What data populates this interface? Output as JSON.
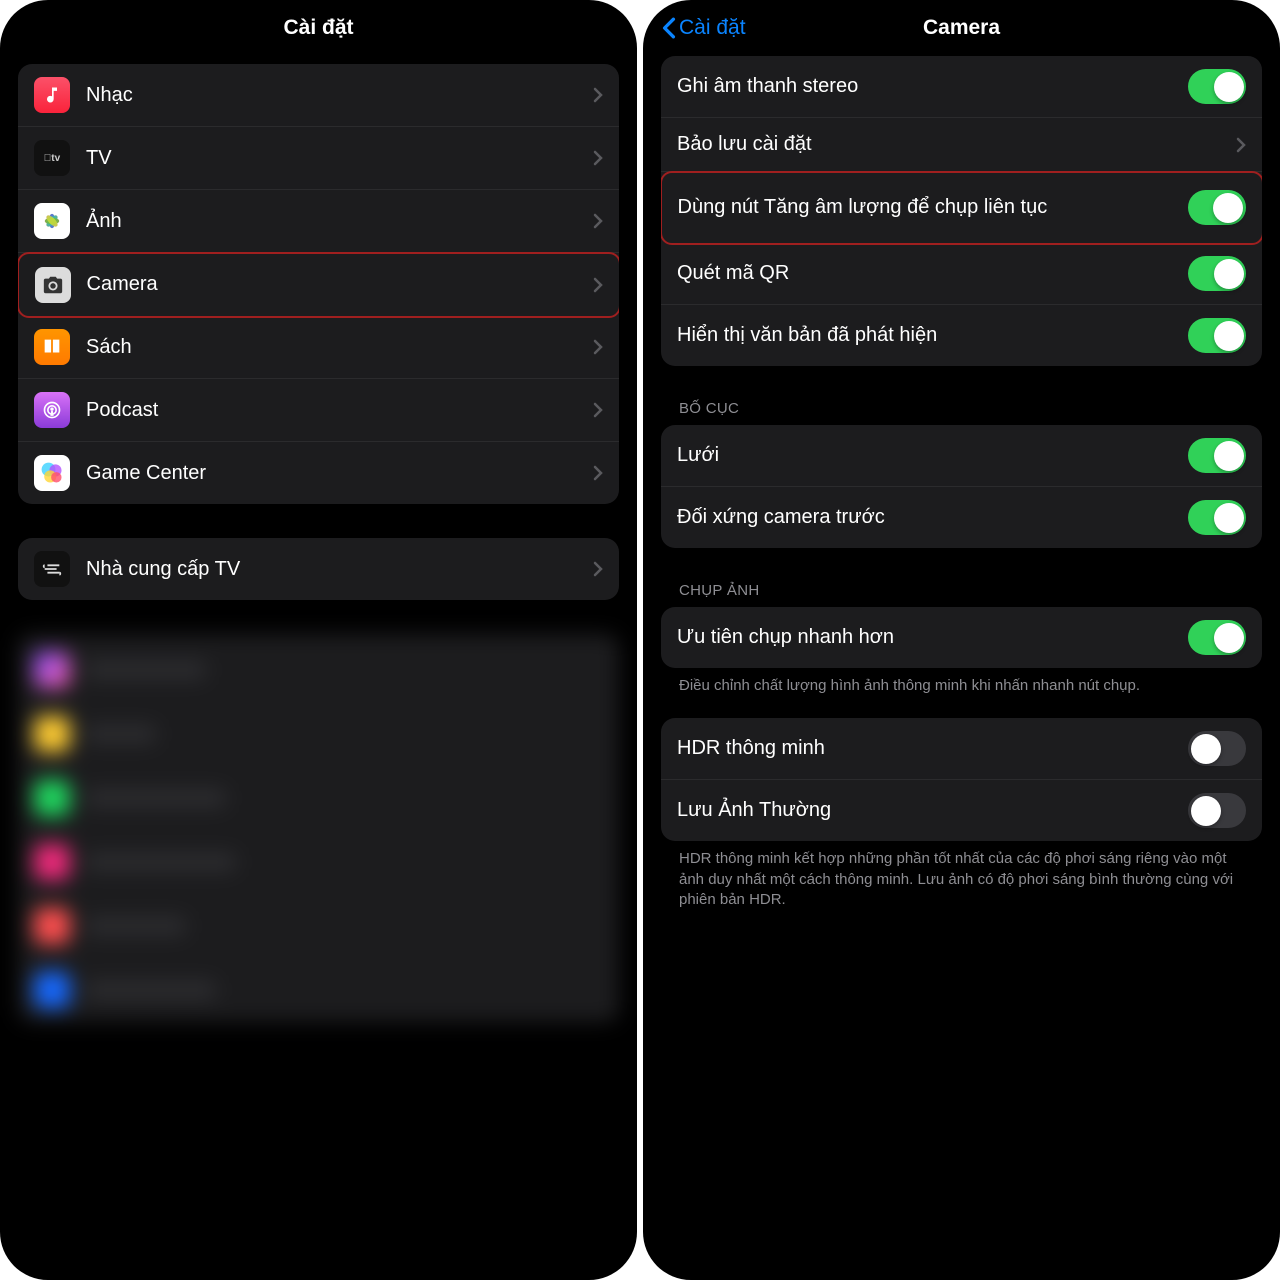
{
  "left": {
    "title": "Cài đặt",
    "group1": [
      {
        "label": "Nhạc",
        "icon": "music"
      },
      {
        "label": "TV",
        "icon": "tv"
      },
      {
        "label": "Ảnh",
        "icon": "photos"
      },
      {
        "label": "Camera",
        "icon": "camera",
        "highlight": true
      },
      {
        "label": "Sách",
        "icon": "books"
      },
      {
        "label": "Podcast",
        "icon": "podcast"
      },
      {
        "label": "Game Center",
        "icon": "game-center"
      }
    ],
    "group2": [
      {
        "label": "Nhà cung cấp TV",
        "icon": "tv-provider"
      }
    ]
  },
  "right": {
    "back": "Cài đặt",
    "title": "Camera",
    "group_top": [
      {
        "label": "Ghi âm thanh stereo",
        "toggle": true
      },
      {
        "label": "Bảo lưu cài đặt",
        "type": "link"
      },
      {
        "label": "Dùng nút Tăng âm lượng để chụp liên tục",
        "toggle": true,
        "highlight": true
      },
      {
        "label": "Quét mã QR",
        "toggle": true
      },
      {
        "label": "Hiển thị văn bản đã phát hiện",
        "toggle": true
      }
    ],
    "layout_header": "BỐ CỤC",
    "group_layout": [
      {
        "label": "Lưới",
        "toggle": true
      },
      {
        "label": "Đối xứng camera trước",
        "toggle": true
      }
    ],
    "capture_header": "CHỤP ẢNH",
    "group_capture": [
      {
        "label": "Ưu tiên chụp nhanh hơn",
        "toggle": true
      }
    ],
    "capture_footer": "Điều chỉnh chất lượng hình ảnh thông minh khi nhấn nhanh nút chụp.",
    "group_hdr": [
      {
        "label": "HDR thông minh",
        "toggle": false
      },
      {
        "label": "Lưu Ảnh Thường",
        "toggle": false
      }
    ],
    "hdr_footer": "HDR thông minh kết hợp những phần tốt nhất của các độ phơi sáng riêng vào một ảnh duy nhất một cách thông minh. Lưu ảnh có độ phơi sáng bình thường cùng với phiên bản HDR."
  }
}
